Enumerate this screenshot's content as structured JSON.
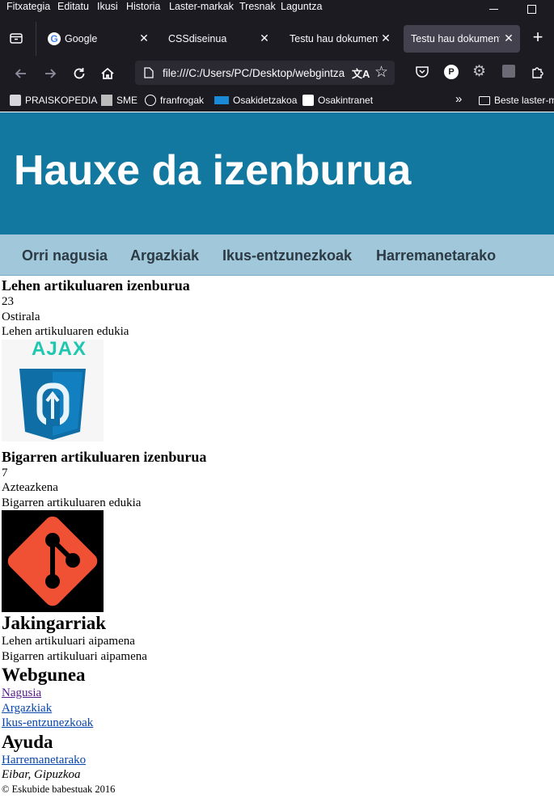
{
  "menubar": {
    "items": [
      "Fitxategia",
      "Editatu",
      "Ikusi",
      "Historia",
      "Laster-markak",
      "Tresnak",
      "Laguntza"
    ]
  },
  "tabs": [
    {
      "title": "Google"
    },
    {
      "title": "CSSdiseinua"
    },
    {
      "title": "Testu hau dokumenti"
    },
    {
      "title": "Testu hau dokumentu"
    }
  ],
  "urlbar": {
    "url": "file:///C:/Users/PC/Desktop/webgintza"
  },
  "bookmarks": [
    {
      "label": "PRAISKOPEDIA"
    },
    {
      "label": "SME"
    },
    {
      "label": "franfrogak"
    },
    {
      "label": "Osakidetzakoa"
    },
    {
      "label": "Osakintranet"
    },
    {
      "label": "Beste laster-m"
    }
  ],
  "header": {
    "title": "Hauxe da izenburua"
  },
  "nav": [
    "Orri nagusia",
    "Argazkiak",
    "Ikus-entzunezkoak",
    "Harremanetarako"
  ],
  "articles": [
    {
      "title": "Lehen artikuluaren izenburua",
      "day": "23",
      "weekday": "Ostirala",
      "content": "Lehen artikuluaren edukia",
      "image_label": "AJAX"
    },
    {
      "title": "Bigarren artikuluaren izenburua",
      "day": "7",
      "weekday": "Azteazkena",
      "content": "Bigarren artikuluaren edukia"
    }
  ],
  "aside": {
    "title": "Jakingarriak",
    "items": [
      "Lehen artikuluari aipamena",
      "Bigarren artikuluari aipamena"
    ]
  },
  "footer": {
    "web_title": "Webgunea",
    "web_links": [
      "Nagusia",
      "Argazkiak",
      "Ikus-entzunezkoak"
    ],
    "help_title": "Ayuda",
    "help_link": "Harremanetarako",
    "location": "Eibar, Gipuzkoa",
    "copyright": "© Eskubide babestuak 2016"
  },
  "colors": {
    "header_bg": "#13789f",
    "nav_bg": "#a1c7da",
    "chrome_bg": "#1c1b22"
  }
}
